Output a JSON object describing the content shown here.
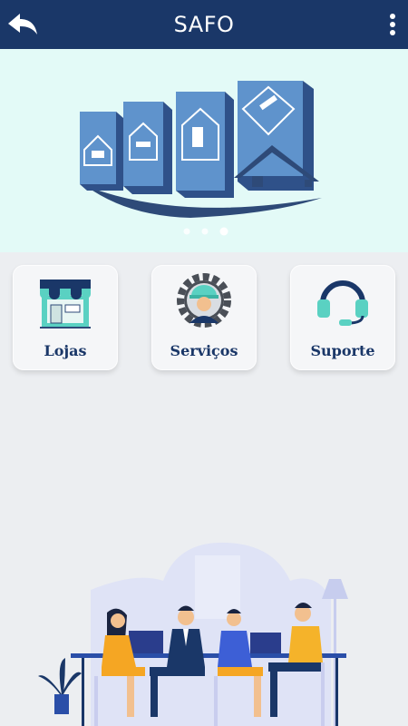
{
  "app_bar": {
    "title": "SAFO"
  },
  "carousel": {
    "total_slides": 3,
    "active_slide": 3
  },
  "menu": {
    "items": [
      {
        "label": "Lojas",
        "icon": "store-icon"
      },
      {
        "label": "Serviços",
        "icon": "worker-gear-icon"
      },
      {
        "label": "Suporte",
        "icon": "headset-icon"
      }
    ]
  },
  "colors": {
    "primary": "#1a3768",
    "banner_bg": "#e3faf7",
    "teal": "#5ad1c2",
    "page_bg": "#eceef1"
  }
}
